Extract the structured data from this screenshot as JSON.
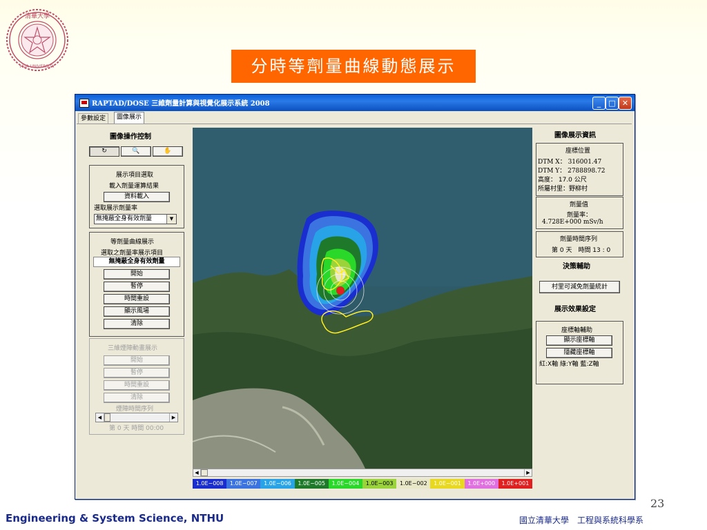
{
  "slide": {
    "title": "分時等劑量曲線動態展示",
    "page_number": "23",
    "footer_left": "Engineering & System Science, NTHU",
    "footer_right": "國立清華大學　工程與系統科學系",
    "title_bg": "#ff6600"
  },
  "window": {
    "title": "RAPTAD/DOSE 三維劑量計算與視覺化展示系統 2008",
    "controls": {
      "minimize": "_",
      "maximize": "□",
      "close": "✕"
    },
    "tabs": [
      "參數設定",
      "圖像展示"
    ]
  },
  "left_panel": {
    "header": "圖像操作控制",
    "tool_icons": [
      "rotate-icon",
      "zoom-icon",
      "pan-icon"
    ],
    "tool_glyphs": [
      "↻",
      "🔍",
      "✋"
    ],
    "display_group": {
      "title": "展示項目選取",
      "load_label": "載入劑量運算結果",
      "load_button": "資料載入",
      "rate_label": "選取展示劑量率",
      "rate_value": "無掩蔽全身有效劑量"
    },
    "contour_group": {
      "title": "等劑量曲線展示",
      "selected_label": "選取之劑量率展示項目",
      "selected_value": "無掩蔽全身有效劑量",
      "buttons": [
        "開始",
        "暫停",
        "時間重設",
        "顯示風場",
        "清除"
      ]
    },
    "track_group": {
      "title": "三維煙陣動畫展示",
      "buttons": [
        "開始",
        "暫停",
        "時間重設",
        "清除"
      ],
      "timeline_label": "煙陣時間序列",
      "time_text": "第 0 天  時間 00:00"
    }
  },
  "legend": [
    {
      "label": "1.0E−008",
      "color": "#1a2ed0"
    },
    {
      "label": "1.0E−007",
      "color": "#3b73e0"
    },
    {
      "label": "1.0E−006",
      "color": "#28a3e8"
    },
    {
      "label": "1.0E−005",
      "color": "#1e7a2a"
    },
    {
      "label": "1.0E−004",
      "color": "#29d829"
    },
    {
      "label": "1.0E−003",
      "color": "#9ad43a"
    },
    {
      "label": "1.0E−002",
      "color": "#e8e8c8"
    },
    {
      "label": "1.0E−001",
      "color": "#e8d820"
    },
    {
      "label": "1.0E+000",
      "color": "#e070e0"
    },
    {
      "label": "1.0E+001",
      "color": "#e02020"
    }
  ],
  "right_panel": {
    "header": "圖像展示資訊",
    "coord_title": "座標位置",
    "dtm_x": "DTM X： 316001.47",
    "dtm_y": "DTM Y： 2788898.72",
    "height": "高度：  17.0 公尺",
    "village": "所屬村里：野柳村",
    "dose_title": "劑量值",
    "dose_rate_label": "劑量率：",
    "dose_rate_value": "4.728E+000 mSv/h",
    "time_series_title": "劑量時間序列",
    "time_value": "第 0 天　時間 13 : 0",
    "decision_header": "決策輔助",
    "village_button": "村里可減免劑量統計",
    "effect_header": "展示效果設定",
    "axis_title": "座標軸輔助",
    "show_axis_button": "顯示座標軸",
    "hide_axis_button": "隱藏座標軸",
    "axis_legend": "紅:X軸  綠:Y軸  藍:Z軸"
  }
}
